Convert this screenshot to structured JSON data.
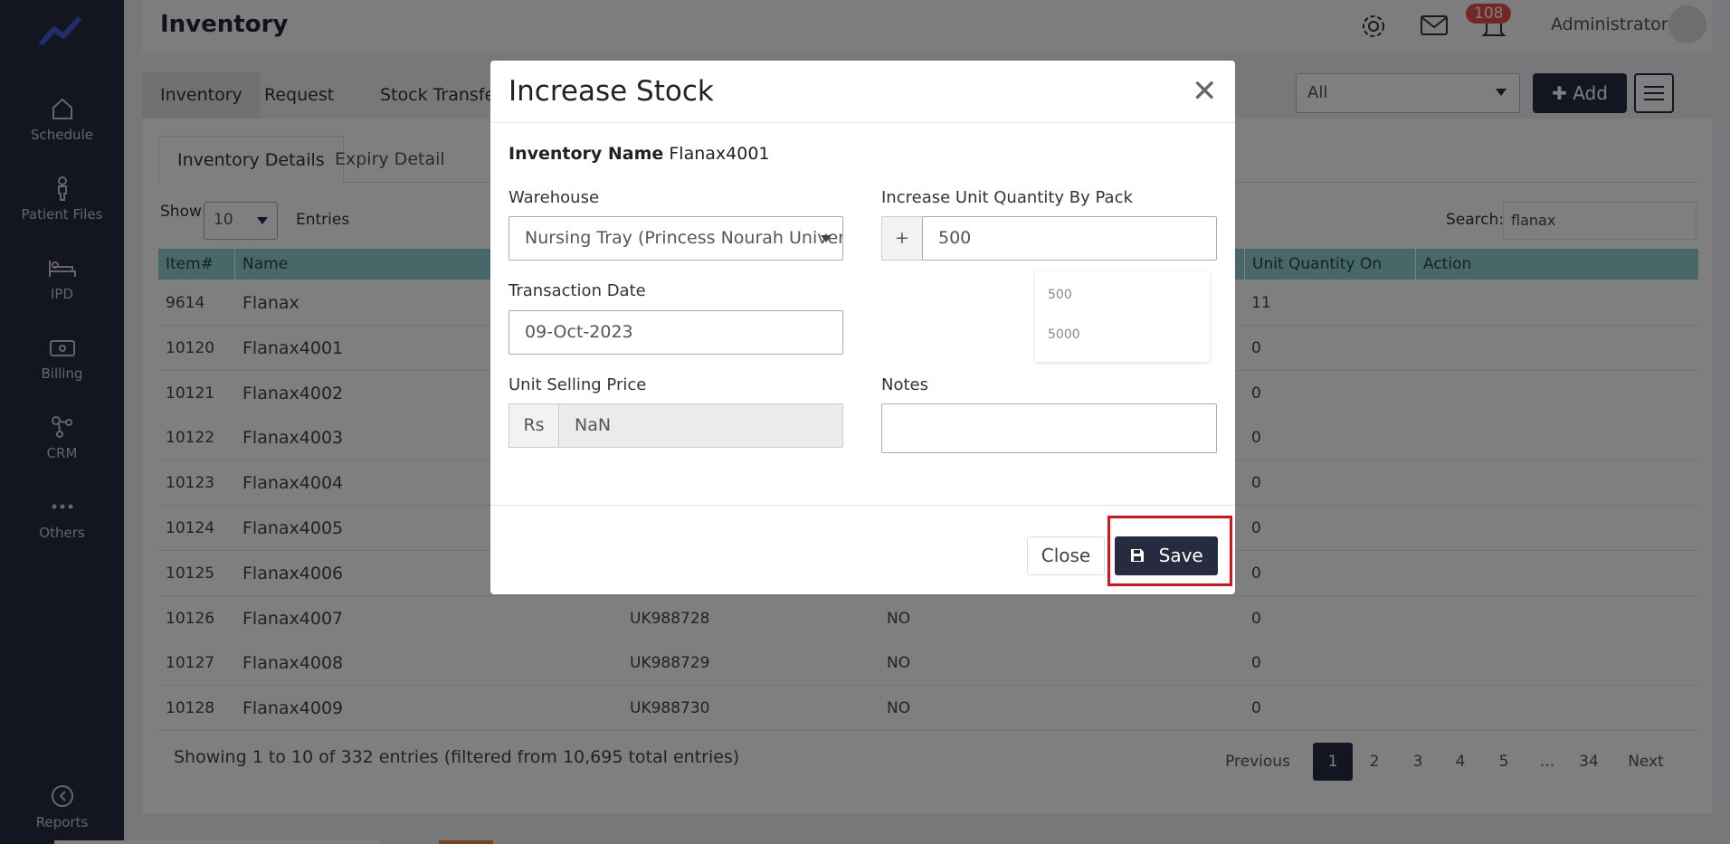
{
  "sidebar": {
    "items": [
      {
        "label": "Schedule",
        "icon": "home-icon"
      },
      {
        "label": "Patient Files",
        "icon": "person-icon"
      },
      {
        "label": "IPD",
        "icon": "bed-icon"
      },
      {
        "label": "Billing",
        "icon": "cash-icon"
      },
      {
        "label": "CRM",
        "icon": "network-icon"
      },
      {
        "label": "Others",
        "icon": "more-icon"
      },
      {
        "label": "Reports",
        "icon": "gauge-icon"
      }
    ]
  },
  "header": {
    "title": "Inventory",
    "notification_count": "108",
    "user": "Administrator"
  },
  "top_tabs": [
    "Inventory",
    "Request",
    "Stock Transfer"
  ],
  "filter": {
    "value": "All"
  },
  "add_label": "Add",
  "inner_tabs": [
    "Inventory Details",
    "Expiry Detail"
  ],
  "table_controls": {
    "show_label": "Show",
    "show_value": "10",
    "entries_label": "Entries",
    "search_label": "Search:",
    "search_value": "flanax"
  },
  "table": {
    "columns": [
      "Item#",
      "Name",
      "Unit Quantity On Hand",
      "Action"
    ],
    "rows": [
      {
        "item": "9614",
        "name": "Flanax",
        "code": "",
        "flag": "",
        "qty": "11"
      },
      {
        "item": "10120",
        "name": "Flanax4001",
        "code": "",
        "flag": "",
        "qty": "0"
      },
      {
        "item": "10121",
        "name": "Flanax4002",
        "code": "",
        "flag": "",
        "qty": "0"
      },
      {
        "item": "10122",
        "name": "Flanax4003",
        "code": "",
        "flag": "",
        "qty": "0"
      },
      {
        "item": "10123",
        "name": "Flanax4004",
        "code": "",
        "flag": "",
        "qty": "0"
      },
      {
        "item": "10124",
        "name": "Flanax4005",
        "code": "",
        "flag": "",
        "qty": "0"
      },
      {
        "item": "10125",
        "name": "Flanax4006",
        "code": "",
        "flag": "",
        "qty": "0"
      },
      {
        "item": "10126",
        "name": "Flanax4007",
        "code": "UK988728",
        "flag": "NO",
        "qty": "0"
      },
      {
        "item": "10127",
        "name": "Flanax4008",
        "code": "UK988729",
        "flag": "NO",
        "qty": "0"
      },
      {
        "item": "10128",
        "name": "Flanax4009",
        "code": "UK988730",
        "flag": "NO",
        "qty": "0"
      }
    ]
  },
  "pagination": {
    "info": "Showing 1 to 10 of 332 entries (filtered from 10,695 total entries)",
    "previous": "Previous",
    "pages": [
      "1",
      "2",
      "3",
      "4",
      "5",
      "...",
      "34"
    ],
    "next": "Next",
    "current": "1"
  },
  "modal": {
    "title": "Increase Stock",
    "inventory_name_label": "Inventory Name",
    "inventory_name_value": "Flanax4001",
    "warehouse_label": "Warehouse",
    "warehouse_value": "Nursing Tray (Princess Nourah University)",
    "increase_label": "Increase Unit Quantity By Pack",
    "increase_prefix": "+",
    "increase_value": "500",
    "increase_options": [
      "500",
      "5000"
    ],
    "date_label": "Transaction Date",
    "date_value": "09-Oct-2023",
    "price_label": "Unit Selling Price",
    "price_prefix": "Rs",
    "price_value": "NaN",
    "notes_label": "Notes",
    "notes_value": "",
    "close_label": "Close",
    "save_label": "Save"
  },
  "colors": {
    "sidebar": "#262b40",
    "table_header": "#8ecfd1",
    "primary_button": "#262b40",
    "highlight_box": "#d9131c",
    "badge": "#e5534b"
  }
}
